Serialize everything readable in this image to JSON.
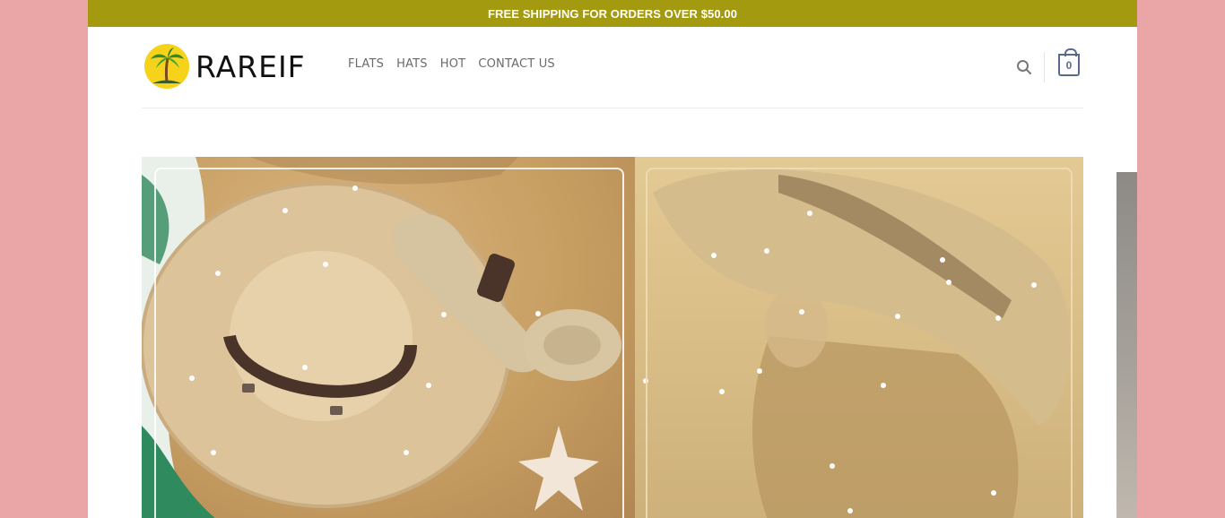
{
  "promo": {
    "text": "FREE SHIPPING FOR ORDERS OVER $50.00"
  },
  "header": {
    "logo_text": "RAREIF",
    "nav": [
      {
        "label": "FLATS"
      },
      {
        "label": "HATS"
      },
      {
        "label": "HOT"
      },
      {
        "label": "CONTACT US"
      }
    ],
    "cart_count": "0",
    "icons": {
      "logo": "palm-tree-sun-icon",
      "search": "search-icon",
      "cart": "shopping-bag-icon"
    }
  },
  "colors": {
    "promo_bar": "#a39a10",
    "page_background": "#eaa5a7",
    "nav_text": "#6b6b6b",
    "cart_accent": "#5a6a86"
  },
  "hero": {
    "images": [
      "straw-hats-on-sand",
      "woman-in-wide-brim-straw-hat"
    ]
  }
}
